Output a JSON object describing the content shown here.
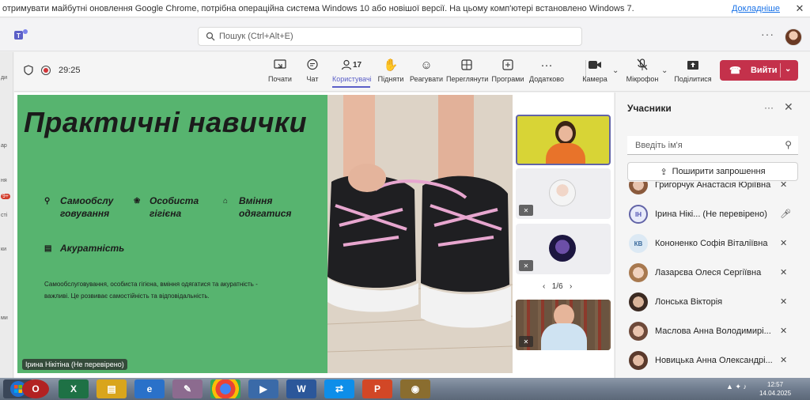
{
  "infobar": {
    "message": "отримувати майбутні оновлення Google Chrome, потрібна операційна система Windows 10 або новішої версії. На цьому комп'ютері встановлено Windows 7.",
    "more_link": "Докладніше",
    "close": "✕"
  },
  "header": {
    "search_placeholder": "Пошук (Ctrl+Alt+E)",
    "more": "···"
  },
  "rail": {
    "labels": [
      "ди",
      "ар",
      "ня",
      "9+",
      "сті",
      "ки",
      "ми"
    ]
  },
  "meeting": {
    "timer": "29:25",
    "tools": [
      {
        "label": "Почати",
        "icon": "share-screen-icon"
      },
      {
        "label": "Чат",
        "icon": "chat-icon"
      },
      {
        "label": "Користувачі",
        "icon": "people-icon",
        "count": "17"
      },
      {
        "label": "Підняти",
        "icon": "raise-hand-icon"
      },
      {
        "label": "Реагувати",
        "icon": "react-icon"
      },
      {
        "label": "Переглянути",
        "icon": "view-icon"
      },
      {
        "label": "Програми",
        "icon": "apps-icon"
      },
      {
        "label": "Додатково",
        "icon": "more-icon"
      },
      {
        "label": "Камера",
        "icon": "camera-icon"
      },
      {
        "label": "Мікрофон",
        "icon": "mic-off-icon"
      },
      {
        "label": "Поділитися",
        "icon": "share-icon"
      }
    ],
    "leave_label": "Вийти",
    "accent": "#5b5fc7",
    "leave_color": "#c4314b"
  },
  "slide": {
    "title": "Практичні навички",
    "skills": [
      {
        "text": "Самообслу\nговування"
      },
      {
        "text": "Особиста\nгігієна"
      },
      {
        "text": "Вміння\nодягатися"
      },
      {
        "text": "Акуратність"
      }
    ],
    "body_line1": "Самообслуговування, особиста гігієна, вміння одягатися та акуратність -",
    "body_line2": "важливі. Це розвиває самостійність та відповідальність.",
    "presenter": "Ірина Нікітіна (Не перевірено)",
    "green": "#57b46f"
  },
  "gallery": {
    "pager": "1/6"
  },
  "panel": {
    "title": "Учасники",
    "search_placeholder": "Введіть ім'я",
    "invite_label": "Поширити запрошення",
    "participants": [
      {
        "name": "Григорчук Анастасія Юріївна",
        "initials": "",
        "mic": "muted"
      },
      {
        "name": "Ірина Нікі...  (Не перевірено)",
        "initials": "ІН",
        "mic": "on"
      },
      {
        "name": "Кононенко Софія Віталіївна",
        "initials": "КВ",
        "mic": "muted"
      },
      {
        "name": "Лазарєва Олеся Сергіївна",
        "initials": "",
        "mic": "muted"
      },
      {
        "name": "Лонська Вікторія",
        "initials": "",
        "mic": "muted"
      },
      {
        "name": "Маслова Анна Володимирі...",
        "initials": "",
        "mic": "muted"
      },
      {
        "name": "Новицька Анна Олександрі...",
        "initials": "",
        "mic": "muted"
      }
    ]
  },
  "taskbar": {
    "apps": [
      "opera-icon",
      "excel-icon",
      "explorer-icon",
      "ie-icon",
      "paint-icon",
      "chrome-icon",
      "media-icon",
      "word-icon",
      "teamviewer-icon",
      "powerpoint-icon",
      "vpn-icon"
    ],
    "time": "12:57",
    "date": "14.04.2025"
  }
}
